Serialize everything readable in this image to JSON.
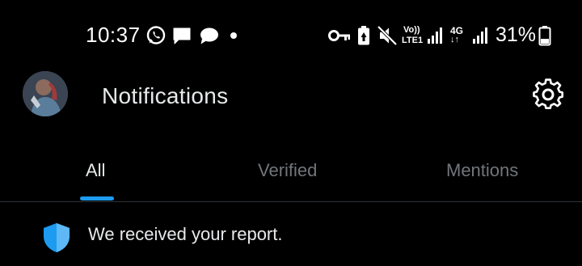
{
  "status_bar": {
    "time": "10:37",
    "network_labels": {
      "volte_top": "Vo))",
      "volte_bottom": "LTE1",
      "fourg_top": "4G",
      "fourg_bottom": "↓↑"
    },
    "battery_percent": "31%",
    "icons": [
      "whatsapp-icon",
      "message-icon",
      "chat-icon",
      "dot-icon",
      "key-icon",
      "battery-saver-icon",
      "mute-icon",
      "volte-icon",
      "signal-icon",
      "4g-icon",
      "signal-icon",
      "battery-icon"
    ]
  },
  "header": {
    "title": "Notifications",
    "avatar": "avatar",
    "settings_icon": "gear-icon"
  },
  "tabs": [
    {
      "label": "All",
      "active": true
    },
    {
      "label": "Verified",
      "active": false
    },
    {
      "label": "Mentions",
      "active": false
    }
  ],
  "notifications": [
    {
      "icon": "shield-icon",
      "text": "We received your report."
    }
  ],
  "colors": {
    "background": "#000000",
    "text_primary": "#e7e9ea",
    "text_secondary": "#71767b",
    "accent": "#1d9bf0",
    "divider": "#2f3336"
  }
}
